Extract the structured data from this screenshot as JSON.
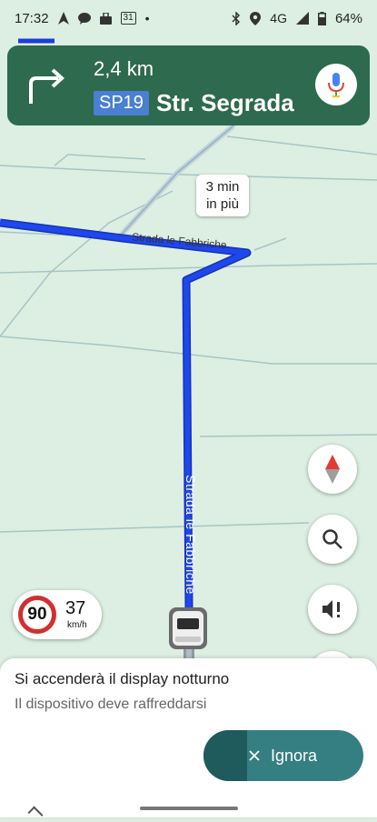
{
  "status_bar": {
    "time": "17:32",
    "network": "4G",
    "battery": "64%",
    "calendar_day": "31"
  },
  "navigation": {
    "distance": "2,4 km",
    "road_badge": "SP19",
    "road_name": "Str. Segrada"
  },
  "map": {
    "time_callout_line1": "3 min",
    "time_callout_line2": "in più",
    "road_label_horizontal": "Strada le Fabbriche",
    "road_label_vertical": "Strada le Fabbriche"
  },
  "speed": {
    "limit": "90",
    "current": "37",
    "unit": "km/h"
  },
  "notice": {
    "title": "Si accenderà il display notturno",
    "subtitle": "Il dispositivo deve raffreddarsi",
    "button_label": "Ignora",
    "button_progress_percent": 27
  },
  "colors": {
    "nav_card": "#2e6a4e",
    "route": "#1a3fd9",
    "button": "#357f83",
    "speed_limit_ring": "#d32f2f"
  },
  "icons": [
    "navigation-arrow-icon",
    "chat-icon",
    "bag-icon",
    "calendar-icon",
    "bluetooth-icon",
    "location-icon",
    "signal-icon",
    "battery-icon",
    "turn-right-icon",
    "mic-icon",
    "compass-icon",
    "search-icon",
    "sound-alert-icon",
    "close-icon"
  ]
}
